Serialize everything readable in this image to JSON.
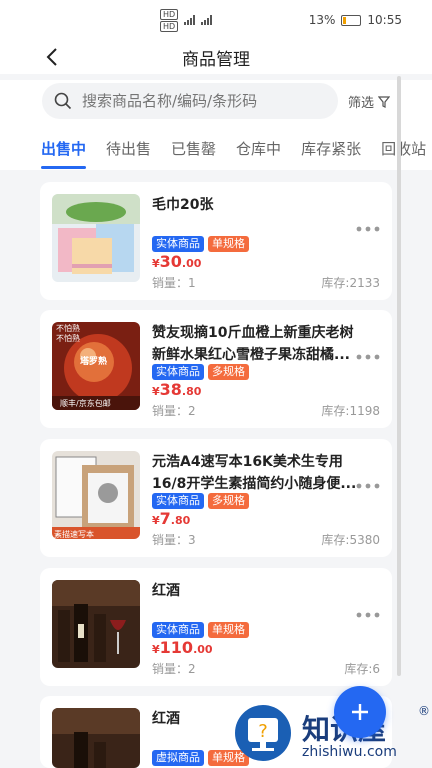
{
  "status_bar": {
    "sim1": "HD",
    "sim2": "HD",
    "battery": "13%",
    "time": "10:55"
  },
  "header": {
    "title": "商品管理"
  },
  "search": {
    "placeholder": "搜索商品名称/编码/条形码",
    "filter_label": "筛选"
  },
  "tabs": [
    {
      "label": "出售中",
      "active": true
    },
    {
      "label": "待出售",
      "active": false
    },
    {
      "label": "已售罄",
      "active": false
    },
    {
      "label": "仓库中",
      "active": false
    },
    {
      "label": "库存紧张",
      "active": false
    },
    {
      "label": "回收站",
      "active": false
    }
  ],
  "products": [
    {
      "name": "毛巾20张",
      "badge1": "实体商品",
      "badge2": "单规格",
      "currency": "¥",
      "price_int": "30",
      "price_dec": ".00",
      "sales": "销量：1",
      "stock": "库存:2133"
    },
    {
      "name": "赞友现摘10斤血橙上新重庆老树新鲜水果红心雪橙子果冻甜橘...",
      "badge1": "实体商品",
      "badge2": "多规格",
      "currency": "¥",
      "price_int": "38",
      "price_dec": ".80",
      "sales": "销量：2",
      "stock": "库存:1198",
      "thumb_text_top": "不怕熟\n不怕熟",
      "thumb_text_bottom": "顺丰/京东包邮",
      "thumb_text_mid": "塔罗熟"
    },
    {
      "name": "元浩A4速写本16K美术生专用16/8开学生素描简约小随身便...",
      "badge1": "实体商品",
      "badge2": "多规格",
      "currency": "¥",
      "price_int": "7",
      "price_dec": ".80",
      "sales": "销量：3",
      "stock": "库存:5380",
      "thumb_text_bottom": "素描速写本"
    },
    {
      "name": "红酒",
      "badge1": "实体商品",
      "badge2": "单规格",
      "currency": "¥",
      "price_int": "110",
      "price_dec": ".00",
      "sales": "销量：2",
      "stock": "库存:6"
    },
    {
      "name": "红酒",
      "badge1": "虚拟商品",
      "badge2": "单规格"
    }
  ],
  "watermark": {
    "text": "知识屋",
    "sub": "zhishiwu.com",
    "reg": "®"
  },
  "colors": {
    "accent": "#2468f2",
    "price": "#e53935",
    "badge_orange": "#f46b3d"
  }
}
